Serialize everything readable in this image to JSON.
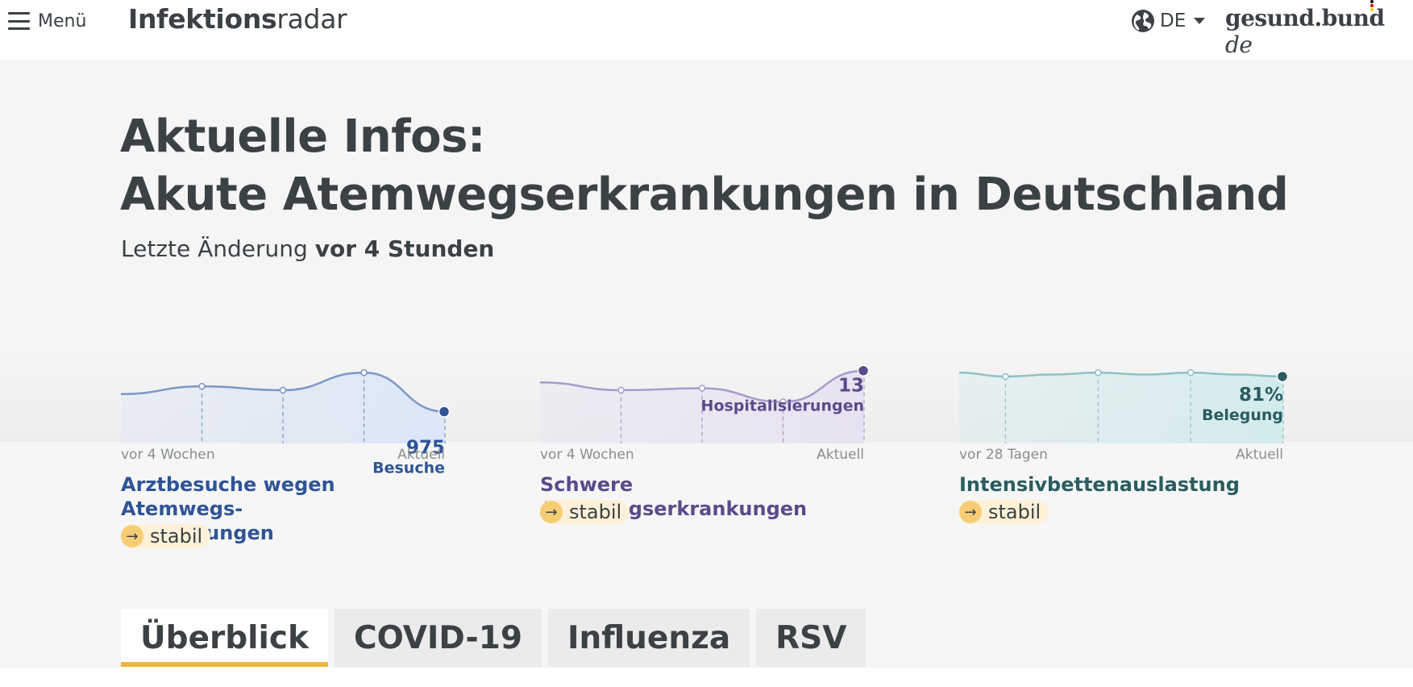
{
  "header": {
    "menu_label": "Menü",
    "brand_bold": "Infektions",
    "brand_regular": "radar",
    "language": "DE",
    "portal_main": "gesund.bund",
    "portal_suffix": "de",
    "portal_dot_colors": [
      "#000000",
      "#dd0000",
      "#ffcc00"
    ]
  },
  "hero": {
    "title_line1": "Aktuelle Infos:",
    "title_line2": "Akute Atemwegserkrankungen in Deutschland",
    "updated_prefix": "Letzte Änderung",
    "updated_value": "vor 4 Stunden"
  },
  "cards": [
    {
      "range_start": "vor 4 Wochen",
      "range_end": "Aktuell",
      "value": "975",
      "unit": "Besuche",
      "title": "Arztbesuche wegen Atemwegs-\nerkrankungen",
      "trend_icon": "arrow-right-icon",
      "trend": "stabil",
      "color": "#2f5496",
      "line_color": "#7b97c6",
      "fill_color": "#dce6f6",
      "chart_data": {
        "type": "area",
        "points": [
          0.22,
          0.26,
          0.24,
          0.33,
          0.13
        ]
      }
    },
    {
      "range_start": "vor 4 Wochen",
      "range_end": "Aktuell",
      "value": "13",
      "unit": "Hospitalisierungen",
      "title": "Schwere Atemwegserkrankungen",
      "trend_icon": "arrow-right-icon",
      "trend": "stabil",
      "color": "#5b4b8a",
      "line_color": "#a79bcd",
      "fill_color": "#e7e2f2",
      "chart_data": {
        "type": "area",
        "points": [
          0.28,
          0.24,
          0.25,
          0.18,
          0.34
        ]
      }
    },
    {
      "range_start": "vor 28 Tagen",
      "range_end": "Aktuell",
      "value": "81%",
      "unit": "Belegung",
      "title": "Intensivbettenauslastung",
      "trend_icon": "arrow-right-icon",
      "trend": "stabil",
      "color": "#2a5c60",
      "line_color": "#8fc2c6",
      "fill_color": "#d3ebed",
      "chart_data": {
        "type": "area",
        "points": [
          0.33,
          0.31,
          0.32,
          0.33,
          0.32,
          0.33,
          0.32,
          0.31
        ]
      }
    }
  ],
  "tabs": [
    {
      "label": "Überblick",
      "active": true
    },
    {
      "label": "COVID-19",
      "active": false
    },
    {
      "label": "Influenza",
      "active": false
    },
    {
      "label": "RSV",
      "active": false
    }
  ]
}
